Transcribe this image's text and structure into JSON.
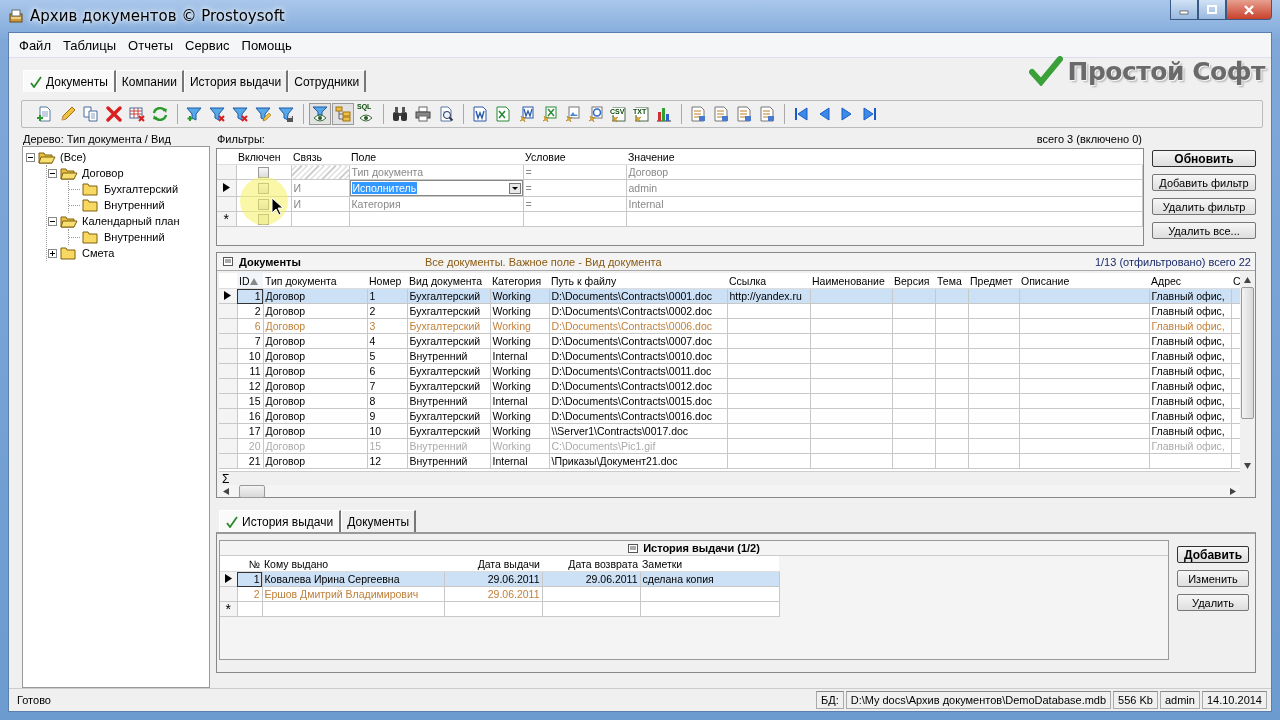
{
  "window": {
    "title": "Архив документов © Prostoysoft"
  },
  "menu": [
    "Файл",
    "Таблицы",
    "Отчеты",
    "Сервис",
    "Помощь"
  ],
  "tabs": [
    {
      "label": "Документы",
      "selected": true
    },
    {
      "label": "Компании",
      "selected": false
    },
    {
      "label": "История выдачи",
      "selected": false
    },
    {
      "label": "Сотрудники",
      "selected": false
    }
  ],
  "logo": {
    "text": "Простой Софт"
  },
  "toolbar": [
    {
      "kind": "doc-add",
      "pressed": false
    },
    {
      "kind": "edit",
      "pressed": false
    },
    {
      "kind": "copy",
      "pressed": false
    },
    {
      "kind": "delete",
      "pressed": false
    },
    {
      "kind": "grid-delete",
      "pressed": false
    },
    {
      "kind": "refresh",
      "pressed": false
    },
    {
      "kind": "separator"
    },
    {
      "kind": "filter-add",
      "pressed": false
    },
    {
      "kind": "filter-delete",
      "pressed": false
    },
    {
      "kind": "filter-delete",
      "pressed": false
    },
    {
      "kind": "filter-edit",
      "pressed": false
    },
    {
      "kind": "filter-save",
      "pressed": false
    },
    {
      "kind": "separator"
    },
    {
      "kind": "filter-eye",
      "pressed": true
    },
    {
      "kind": "tree",
      "pressed": true
    },
    {
      "kind": "sql",
      "label": "SQL",
      "pressed": false
    },
    {
      "kind": "separator"
    },
    {
      "kind": "binoculars",
      "pressed": false
    },
    {
      "kind": "printer",
      "pressed": false
    },
    {
      "kind": "preview",
      "pressed": false
    },
    {
      "kind": "separator"
    },
    {
      "kind": "word",
      "pressed": false
    },
    {
      "kind": "sheet",
      "pressed": false
    },
    {
      "kind": "word-export",
      "pressed": false
    },
    {
      "kind": "sheet-export",
      "pressed": false
    },
    {
      "kind": "image-export",
      "pressed": false
    },
    {
      "kind": "web-export",
      "pressed": false
    },
    {
      "kind": "text-export",
      "label": "CSV",
      "pressed": false
    },
    {
      "kind": "text-export",
      "label": "TXT",
      "pressed": false
    },
    {
      "kind": "chart",
      "pressed": false
    },
    {
      "kind": "separator"
    },
    {
      "kind": "report",
      "pressed": false
    },
    {
      "kind": "report",
      "pressed": false
    },
    {
      "kind": "report",
      "pressed": false
    },
    {
      "kind": "report",
      "pressed": false
    },
    {
      "kind": "separator"
    },
    {
      "kind": "first",
      "pressed": false
    },
    {
      "kind": "prev",
      "pressed": false
    },
    {
      "kind": "next",
      "pressed": false
    },
    {
      "kind": "last",
      "pressed": false
    }
  ],
  "tree": {
    "label": "Дерево: Тип документа / Вид",
    "items": [
      {
        "label": "(Все)",
        "expanded": true,
        "children": [
          {
            "label": "Договор",
            "expanded": true,
            "children": [
              {
                "label": "Бухгалтерский"
              },
              {
                "label": "Внутренний"
              }
            ]
          },
          {
            "label": "Календарный план",
            "expanded": true,
            "children": [
              {
                "label": "Внутренний"
              }
            ]
          },
          {
            "label": "Смета",
            "expanded": false
          }
        ]
      }
    ]
  },
  "filters": {
    "label": "Фильтры:",
    "summary": "всего 3 (включено 0)",
    "columns": [
      "Включен",
      "Связь",
      "Поле",
      "Условие",
      "Значение"
    ],
    "rows": [
      {
        "enabled": false,
        "field": "Тип документа",
        "condition": "=",
        "value": "Договор",
        "selected": false,
        "editing": false
      },
      {
        "enabled": false,
        "link": "И",
        "field": "Исполнитель",
        "condition": "=",
        "value": "admin",
        "selected": true,
        "editing": true
      },
      {
        "enabled": false,
        "link": "И",
        "field": "Категория",
        "condition": "=",
        "value": "Internal",
        "selected": false,
        "editing": false
      }
    ],
    "new_row_marker": "*",
    "new_row_enabled": false,
    "buttons": [
      {
        "label": "Обновить",
        "default": true
      },
      {
        "label": "Добавить фильтр",
        "default": false
      },
      {
        "label": "Удалить фильтр",
        "default": false
      },
      {
        "label": "Удалить все...",
        "default": false
      }
    ]
  },
  "documents": {
    "title": "Документы",
    "subtitle": "Все документы. Важное поле - Вид документа",
    "count": "1/13 (отфильтровано) всего 22",
    "columns": [
      {
        "label": "ID",
        "sorted": true
      },
      {
        "label": "Тип документа",
        "sorted": false
      },
      {
        "label": "Номер",
        "sorted": false
      },
      {
        "label": "Вид документа",
        "sorted": false
      },
      {
        "label": "Категория",
        "sorted": false
      },
      {
        "label": "Путь к файлу",
        "sorted": false
      },
      {
        "label": "Ссылка",
        "sorted": false
      },
      {
        "label": "Наименование",
        "sorted": false
      },
      {
        "label": "Версия",
        "sorted": false
      },
      {
        "label": "Тема",
        "sorted": false
      },
      {
        "label": "Предмет",
        "sorted": false
      },
      {
        "label": "Описание",
        "sorted": false
      },
      {
        "label": "Адрес",
        "sorted": false
      },
      {
        "label": "С",
        "sorted": false
      }
    ],
    "rows": [
      {
        "id": "1",
        "doc_type": "Договор",
        "number": "1",
        "doc_kind": "Бухгалтерский",
        "category": "Working",
        "path": "D:\\Documents\\Contracts\\0001.doc",
        "link": "http://yandex.ru",
        "address": "Главный офис,",
        "marked": false,
        "dimmed": false,
        "selected": true
      },
      {
        "id": "2",
        "doc_type": "Договор",
        "number": "2",
        "doc_kind": "Бухгалтерский",
        "category": "Working",
        "path": "D:\\Documents\\Contracts\\0002.doc",
        "address": "Главный офис,",
        "marked": false,
        "dimmed": false,
        "selected": false
      },
      {
        "id": "6",
        "doc_type": "Договор",
        "number": "3",
        "doc_kind": "Бухгалтерский",
        "category": "Working",
        "path": "D:\\Documents\\Contracts\\0006.doc",
        "address": "Главный офис,",
        "marked": true,
        "dimmed": false,
        "selected": false
      },
      {
        "id": "7",
        "doc_type": "Договор",
        "number": "4",
        "doc_kind": "Бухгалтерский",
        "category": "Working",
        "path": "D:\\Documents\\Contracts\\0007.doc",
        "address": "Главный офис,",
        "marked": false,
        "dimmed": false,
        "selected": false
      },
      {
        "id": "10",
        "doc_type": "Договор",
        "number": "5",
        "doc_kind": "Внутренний",
        "category": "Internal",
        "path": "D:\\Documents\\Contracts\\0010.doc",
        "address": "Главный офис,",
        "marked": false,
        "dimmed": false,
        "selected": false
      },
      {
        "id": "11",
        "doc_type": "Договор",
        "number": "6",
        "doc_kind": "Бухгалтерский",
        "category": "Working",
        "path": "D:\\Documents\\Contracts\\0011.doc",
        "address": "Главный офис,",
        "marked": false,
        "dimmed": false,
        "selected": false
      },
      {
        "id": "12",
        "doc_type": "Договор",
        "number": "7",
        "doc_kind": "Бухгалтерский",
        "category": "Working",
        "path": "D:\\Documents\\Contracts\\0012.doc",
        "address": "Главный офис,",
        "marked": false,
        "dimmed": false,
        "selected": false
      },
      {
        "id": "15",
        "doc_type": "Договор",
        "number": "8",
        "doc_kind": "Внутренний",
        "category": "Internal",
        "path": "D:\\Documents\\Contracts\\0015.doc",
        "address": "Главный офис,",
        "marked": false,
        "dimmed": false,
        "selected": false
      },
      {
        "id": "16",
        "doc_type": "Договор",
        "number": "9",
        "doc_kind": "Бухгалтерский",
        "category": "Working",
        "path": "D:\\Documents\\Contracts\\0016.doc",
        "address": "Главный офис,",
        "marked": false,
        "dimmed": false,
        "selected": false
      },
      {
        "id": "17",
        "doc_type": "Договор",
        "number": "10",
        "doc_kind": "Бухгалтерский",
        "category": "Working",
        "path": "\\\\Server1\\Contracts\\0017.doc",
        "address": "Главный офис,",
        "marked": false,
        "dimmed": false,
        "selected": false
      },
      {
        "id": "20",
        "doc_type": "Договор",
        "number": "15",
        "doc_kind": "Внутренний",
        "category": "Working",
        "path": "C:\\Documents\\Pic1.gif",
        "address": "Главный офис,",
        "marked": false,
        "dimmed": true,
        "selected": false
      },
      {
        "id": "21",
        "doc_type": "Договор",
        "number": "12",
        "doc_kind": "Внутренний",
        "category": "Internal",
        "path": "\\Приказы\\Документ21.doc",
        "marked": false,
        "dimmed": false,
        "selected": false
      }
    ],
    "footer": "Σ"
  },
  "bottom_tabs": [
    {
      "label": "История выдачи",
      "selected": true
    },
    {
      "label": "Документы",
      "selected": false
    }
  ],
  "history": {
    "title": "История выдачи (1/2)",
    "columns": [
      "№",
      "Кому выдано",
      "Дата выдачи",
      "Дата возврата",
      "Заметки"
    ],
    "rows": [
      {
        "no": "1",
        "person": "Ковалева Ирина Сергеевна",
        "issued": "29.06.2011",
        "returned": "29.06.2011",
        "notes": "сделана копия",
        "marked": false,
        "selected": true
      },
      {
        "no": "2",
        "person": "Ершов Дмитрий Владимирович",
        "issued": "29.06.2011",
        "marked": true,
        "selected": false
      }
    ],
    "new_row_marker": "*",
    "buttons": [
      {
        "label": "Добавить",
        "default": true
      },
      {
        "label": "Изменить",
        "default": false
      },
      {
        "label": "Удалить",
        "default": false
      }
    ]
  },
  "status_bar": {
    "message": "Готово",
    "db_label": "БД:",
    "db_path": "D:\\My docs\\Архив документов\\DemoDatabase.mdb",
    "size": "556 Kb",
    "user": "admin",
    "date": "14.10.2014"
  }
}
